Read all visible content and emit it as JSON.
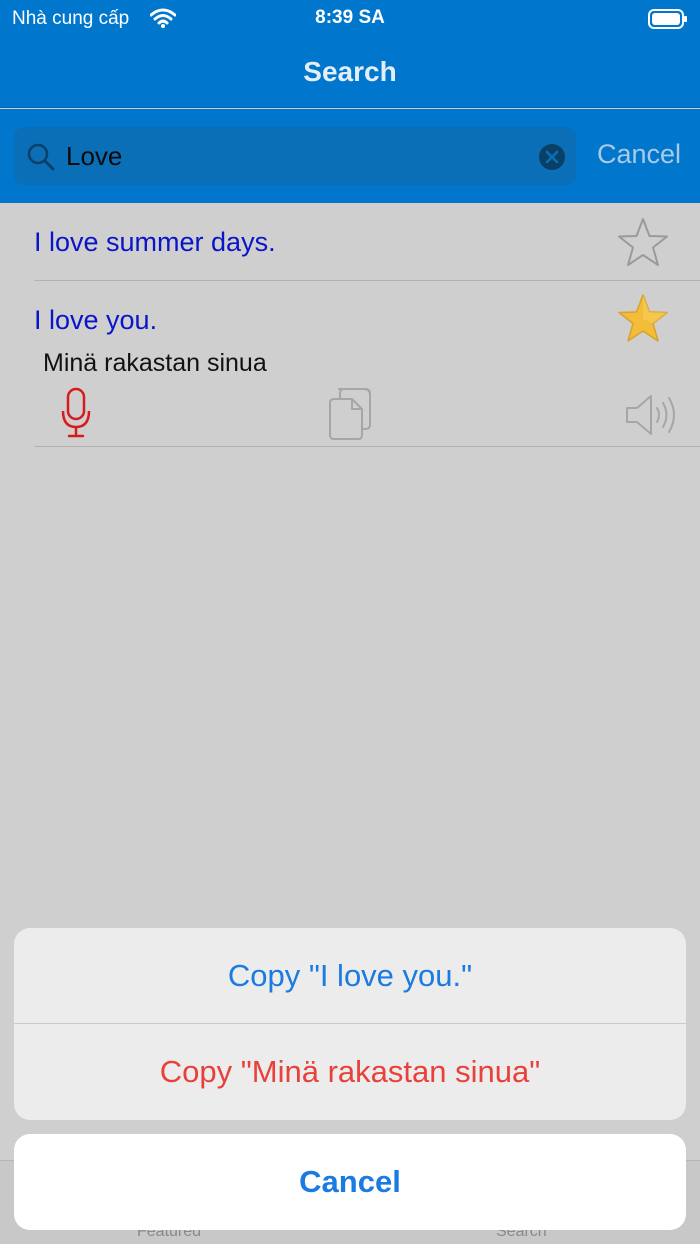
{
  "status_bar": {
    "carrier": "Nhà cung cấp",
    "time": "8:39 SA"
  },
  "nav": {
    "title": "Search"
  },
  "search": {
    "value": "Love",
    "cancel_label": "Cancel"
  },
  "results": [
    {
      "phrase": "I love summer days.",
      "favorite": false
    },
    {
      "phrase": "I love you.",
      "translation": "Minä rakastan sinua",
      "favorite": true
    }
  ],
  "tabs": [
    {
      "label": "Featured"
    },
    {
      "label": "Search"
    }
  ],
  "action_sheet": {
    "items": [
      {
        "label": "Copy \"I love you.\""
      },
      {
        "label": "Copy \"Minä rakastan sinua\""
      }
    ],
    "cancel_label": "Cancel"
  },
  "colors": {
    "brand_blue": "#0077cc",
    "phrase_blue": "#0a14c8",
    "action_blue": "#1a7be0",
    "destructive_red": "#e8413b",
    "mic_red": "#d71a1a",
    "star_gold": "#f2bd39"
  }
}
